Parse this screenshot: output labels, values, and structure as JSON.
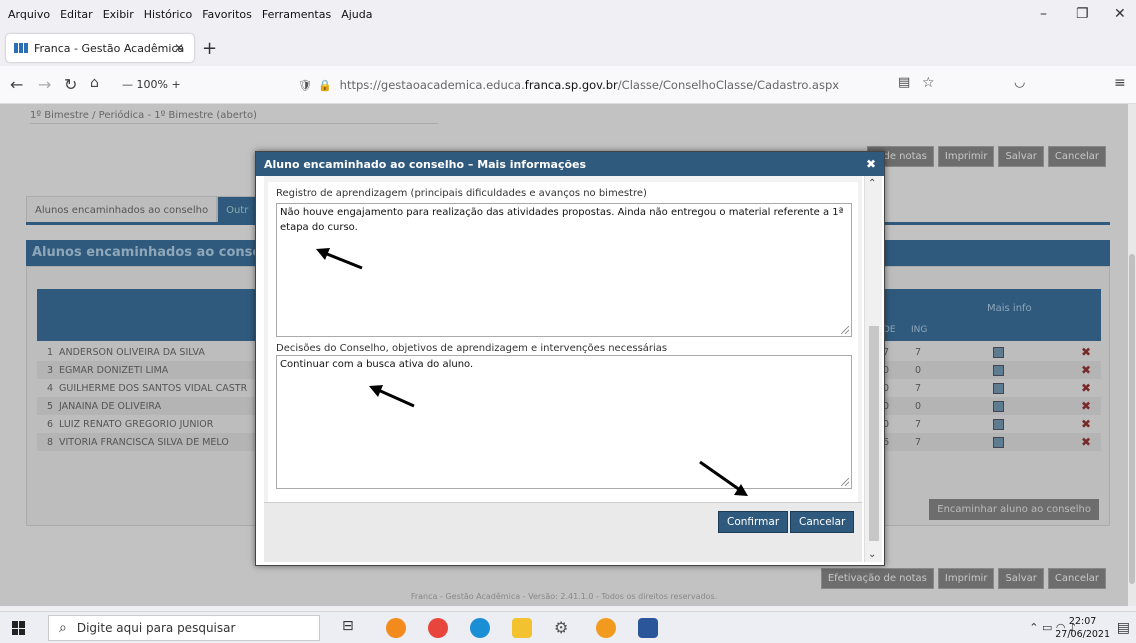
{
  "browser": {
    "menu": [
      "Arquivo",
      "Editar",
      "Exibir",
      "Histórico",
      "Favoritos",
      "Ferramentas",
      "Ajuda"
    ],
    "tab_title": "Franca - Gestão Acadêmica",
    "zoom": "100%",
    "url_prefix": "https://gestaoacademica.educa.",
    "url_domain": "franca.sp.gov.br",
    "url_path": "/Classe/ConselhoClasse/Cadastro.aspx"
  },
  "page": {
    "period_select": "1º Bimestre / Periódica - 1º Bimestre (aberto)",
    "top_buttons": [
      "o de notas",
      "Imprimir",
      "Salvar",
      "Cancelar"
    ],
    "tabs": [
      "Alunos encaminhados ao conselho",
      "Outr"
    ],
    "panel_title": "Alunos encaminhados ao conselho",
    "table_header": {
      "col_de": "DE",
      "col_ing": "ING",
      "mais_info": "Mais info"
    },
    "rows": [
      {
        "num": "1",
        "name": "ANDERSON OLIVEIRA DA SILVA",
        "v1": "7",
        "v2": "7"
      },
      {
        "num": "3",
        "name": "EGMAR DONIZETI LIMA",
        "v1": "0",
        "v2": "0"
      },
      {
        "num": "4",
        "name": "GUILHERME DOS SANTOS VIDAL CASTR",
        "v1": "0",
        "v2": "7"
      },
      {
        "num": "5",
        "name": "JANAINA DE OLIVEIRA",
        "v1": "0",
        "v2": "0"
      },
      {
        "num": "6",
        "name": "LUIZ RENATO GREGORIO JUNIOR",
        "v1": "0",
        "v2": "7"
      },
      {
        "num": "8",
        "name": "VITORIA FRANCISCA SILVA DE MELO",
        "v1": "6",
        "v2": "7"
      }
    ],
    "encaminhar_button": "Encaminhar aluno ao conselho",
    "bottom_buttons": [
      "Efetivação de notas",
      "Imprimir",
      "Salvar",
      "Cancelar"
    ],
    "footer": "Franca - Gestão Acadêmica - Versão: 2.41.1.0 - Todos os direitos reservados."
  },
  "modal": {
    "title": "Aluno encaminhado ao conselho – Mais informações",
    "field1_label": "Registro de aprendizagem (principais dificuldades e avanços no bimestre)",
    "field1_value": "Não houve engajamento para realização das atividades propostas. Ainda não entregou o material referente a 1ª etapa do curso.",
    "field2_label": "Decisões do Conselho, objetivos de aprendizagem e intervenções necessárias",
    "field2_value": "Continuar com a busca ativa do aluno.",
    "confirm_label": "Confirmar",
    "cancel_label": "Cancelar"
  },
  "taskbar": {
    "search_placeholder": "Digite aqui para pesquisar",
    "time": "22:07",
    "date": "27/06/2021"
  },
  "colors": {
    "accent": "#2f5a7e"
  }
}
